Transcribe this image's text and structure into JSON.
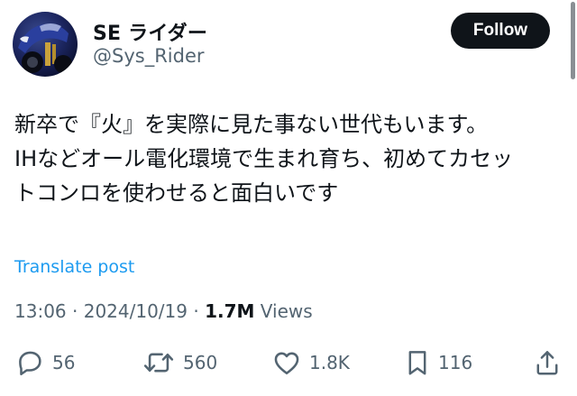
{
  "user": {
    "display_name": "SE ライダー",
    "handle": "@Sys_Rider",
    "follow_label": "Follow"
  },
  "tweet": {
    "lines": [
      "新卒で『火』を実際に見た事ない世代もいます。",
      "IHなどオール電化環境で生まれ育ち、初めてカセッ",
      "トコンロを使わせると面白いです"
    ],
    "translate_label": "Translate post"
  },
  "meta": {
    "time": "13:06",
    "separator": "·",
    "date": "2024/10/19",
    "views_count": "1.7M",
    "views_label": "Views"
  },
  "actions": {
    "replies": "56",
    "reposts": "560",
    "likes": "1.8K",
    "bookmarks": "116"
  },
  "icons": {
    "reply": "reply-icon",
    "repost": "repost-icon",
    "like": "heart-icon",
    "bookmark": "bookmark-icon",
    "share": "share-icon"
  },
  "colors": {
    "text": "#0f1419",
    "secondary": "#536471",
    "link": "#1d9bf0",
    "button_bg": "#0f1419",
    "button_text": "#ffffff"
  }
}
